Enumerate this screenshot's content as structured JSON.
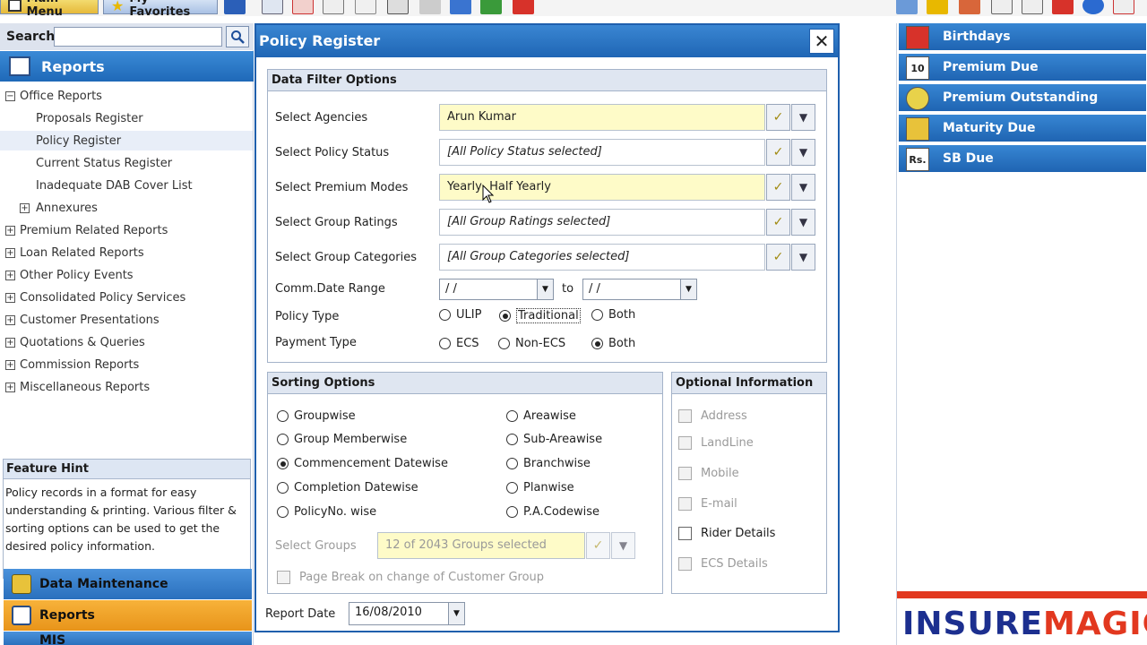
{
  "toolbar": {
    "main_menu": "Main Menu",
    "favorites": "My Favorites"
  },
  "search": {
    "label": "Search",
    "placeholder": ""
  },
  "left": {
    "reports_header": "Reports",
    "tree": [
      {
        "label": "Office Reports",
        "box": "−"
      },
      {
        "label": "Proposals Register"
      },
      {
        "label": "Policy Register"
      },
      {
        "label": "Current Status Register"
      },
      {
        "label": "Inadequate DAB Cover List"
      },
      {
        "label": "Annexures",
        "box": "+"
      },
      {
        "label": "Premium Related Reports",
        "box": "+"
      },
      {
        "label": "Loan Related Reports",
        "box": "+"
      },
      {
        "label": "Other Policy Events",
        "box": "+"
      },
      {
        "label": "Consolidated Policy Services",
        "box": "+"
      },
      {
        "label": "Customer Presentations",
        "box": "+"
      },
      {
        "label": "Quotations & Queries",
        "box": "+"
      },
      {
        "label": "Commission Reports",
        "box": "+"
      },
      {
        "label": "Miscellaneous Reports",
        "box": "+"
      }
    ],
    "hint_title": "Feature Hint",
    "hint_text": "Policy records in a format for easy understanding & printing. Various filter & sorting options can be used to get the desired policy information.",
    "nav": [
      "Data Maintenance",
      "Reports",
      "MIS"
    ]
  },
  "dialog": {
    "title": "Policy Register",
    "close": "✕",
    "filter": {
      "title": "Data Filter Options",
      "rows": [
        {
          "label": "Select Agencies",
          "value": "Arun Kumar"
        },
        {
          "label": "Select Policy Status",
          "value": "[All Policy Status selected]"
        },
        {
          "label": "Select Premium Modes",
          "value": "Yearly, Half Yearly"
        },
        {
          "label": "Select Group Ratings",
          "value": "[All Group Ratings selected]"
        },
        {
          "label": "Select Group Categories",
          "value": "[All Group Categories selected]"
        }
      ],
      "date_range_label": "Comm.Date Range",
      "date_from": " /  /",
      "date_to_label": "to",
      "date_to": " /  /",
      "policy_type_label": "Policy Type",
      "policy_type_options": [
        "ULIP",
        "Traditional",
        "Both"
      ],
      "payment_type_label": "Payment Type",
      "payment_type_options": [
        "ECS",
        "Non-ECS",
        "Both"
      ]
    },
    "sorting": {
      "title": "Sorting Options",
      "left_options": [
        "Groupwise",
        "Group Memberwise",
        "Commencement Datewise",
        "Completion Datewise",
        "PolicyNo. wise"
      ],
      "right_options": [
        "Areawise",
        "Sub-Areawise",
        "Branchwise",
        "Planwise",
        "P.A.Codewise"
      ],
      "select_groups_label": "Select Groups",
      "select_groups_value": "12 of 2043 Groups selected",
      "page_break_label": "Page Break on change of Customer Group"
    },
    "optional": {
      "title": "Optional Information",
      "items": [
        "Address",
        "LandLine",
        "Mobile",
        "E-mail",
        "Rider Details",
        "ECS Details"
      ]
    },
    "report_date_label": "Report Date",
    "report_date_value": "16/08/2010"
  },
  "right": {
    "items": [
      {
        "label": "Birthdays",
        "icon": ""
      },
      {
        "label": "Premium Due",
        "icon": "10"
      },
      {
        "label": "Premium Outstanding",
        "icon": ""
      },
      {
        "label": "Maturity Due",
        "icon": ""
      },
      {
        "label": "SB Due",
        "icon": "Rs."
      }
    ],
    "logo_a": "INSURE",
    "logo_b": "MAGIC"
  }
}
